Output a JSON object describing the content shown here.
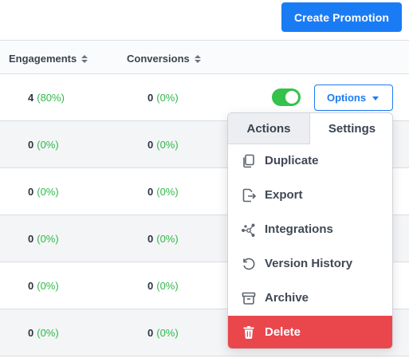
{
  "toolbar": {
    "create_label": "Create Promotion"
  },
  "table": {
    "headers": {
      "engagements": "Engagements",
      "conversions": "Conversions"
    },
    "rows": [
      {
        "eng_count": "4",
        "eng_pct": "(80%)",
        "conv_count": "0",
        "conv_pct": "(0%)"
      },
      {
        "eng_count": "0",
        "eng_pct": "(0%)",
        "conv_count": "0",
        "conv_pct": "(0%)"
      },
      {
        "eng_count": "0",
        "eng_pct": "(0%)",
        "conv_count": "0",
        "conv_pct": "(0%)"
      },
      {
        "eng_count": "0",
        "eng_pct": "(0%)",
        "conv_count": "0",
        "conv_pct": "(0%)"
      },
      {
        "eng_count": "0",
        "eng_pct": "(0%)",
        "conv_count": "0",
        "conv_pct": "(0%)"
      },
      {
        "eng_count": "0",
        "eng_pct": "(0%)",
        "conv_count": "0",
        "conv_pct": "(0%)"
      }
    ],
    "row1_toggle_on": true
  },
  "options": {
    "label": "Options"
  },
  "dropdown": {
    "tabs": {
      "actions": "Actions",
      "settings": "Settings"
    },
    "items": [
      {
        "label": "Duplicate",
        "icon": "duplicate-icon"
      },
      {
        "label": "Export",
        "icon": "export-icon"
      },
      {
        "label": "Integrations",
        "icon": "integrations-icon"
      },
      {
        "label": "Version History",
        "icon": "version-history-icon"
      },
      {
        "label": "Archive",
        "icon": "archive-icon"
      },
      {
        "label": "Delete",
        "icon": "trash-icon"
      }
    ]
  },
  "colors": {
    "primary": "#1a7cf5",
    "success": "#2fb84a",
    "toggle": "#34c24a",
    "danger": "#e9474c"
  }
}
